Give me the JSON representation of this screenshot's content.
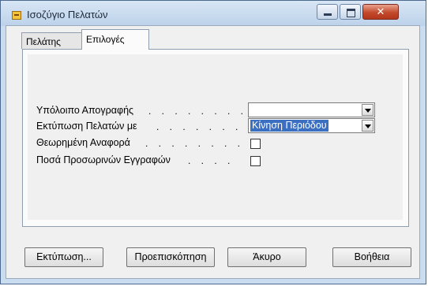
{
  "window": {
    "title": "Ισοζύγιο Πελατών"
  },
  "tabs": [
    {
      "label": "Πελάτης"
    },
    {
      "label": "Επιλογές"
    }
  ],
  "dots": ". . . . . . . . .",
  "options": {
    "inventory_balance": {
      "label": "Υπόλοιπο Απογραφής",
      "value": ""
    },
    "print_customers_with": {
      "label": "Εκτύπωση Πελατών με",
      "value": "Κίνηση Περιόδου"
    },
    "theoretical_report": {
      "label": "Θεωρημένη Αναφορά",
      "checked": false
    },
    "temporary_entries": {
      "label": "Ποσά Προσωρινών Εγγραφών",
      "checked": false
    }
  },
  "buttons": {
    "print": "Εκτύπωση...",
    "preview": "Προεπισκόπηση",
    "cancel": "Άκυρο",
    "help": "Βοήθεια"
  }
}
